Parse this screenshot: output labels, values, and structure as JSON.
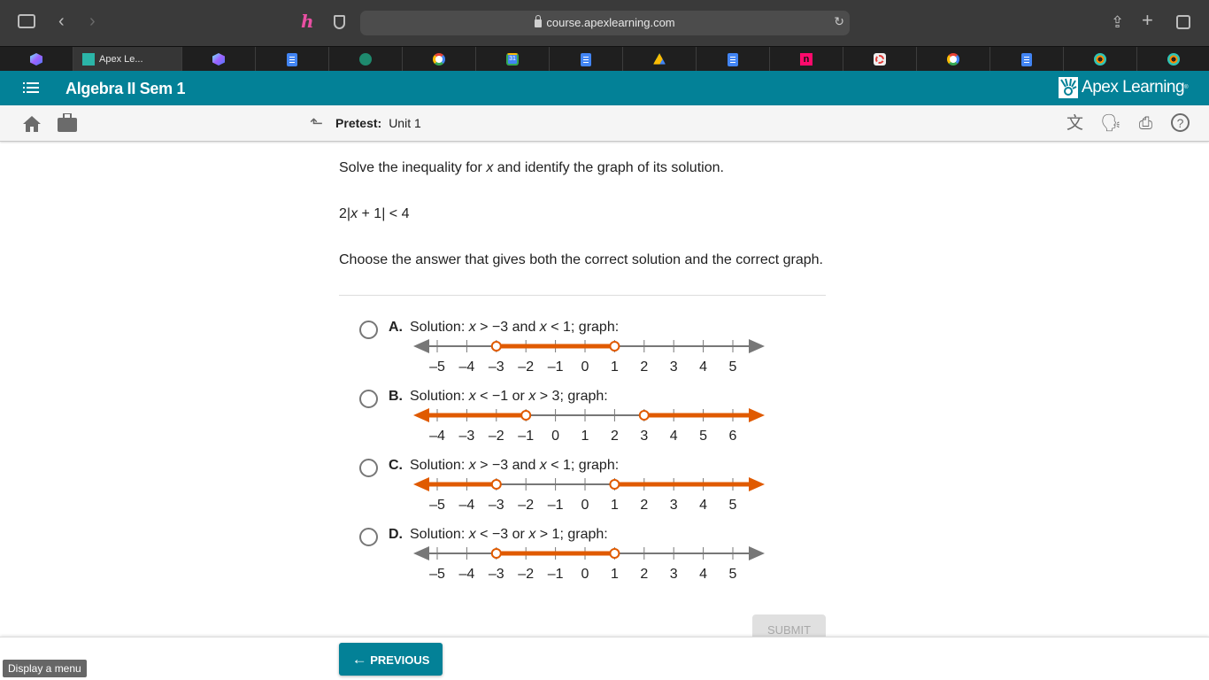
{
  "browser": {
    "url": "course.apexlearning.com",
    "tabs": [
      {
        "icon": "gem",
        "title": ""
      },
      {
        "icon": "apex",
        "title": "Apex Le...",
        "active": true
      },
      {
        "icon": "gem",
        "title": ""
      },
      {
        "icon": "doc",
        "title": ""
      },
      {
        "icon": "gpt",
        "title": ""
      },
      {
        "icon": "google",
        "title": ""
      },
      {
        "icon": "cal",
        "title": "31"
      },
      {
        "icon": "doc",
        "title": ""
      },
      {
        "icon": "drive",
        "title": ""
      },
      {
        "icon": "doc",
        "title": ""
      },
      {
        "icon": "n",
        "title": "n"
      },
      {
        "icon": "ring",
        "title": ""
      },
      {
        "icon": "google",
        "title": ""
      },
      {
        "icon": "doc",
        "title": ""
      },
      {
        "icon": "eye",
        "title": ""
      },
      {
        "icon": "eye",
        "title": ""
      }
    ]
  },
  "header": {
    "course_title": "Algebra II Sem 1",
    "brand": "Apex Learning",
    "brand_mark": "®"
  },
  "subheader": {
    "label": "Pretest:",
    "value": "Unit 1"
  },
  "question": {
    "prompt_before": "Solve the inequality for ",
    "prompt_var": "x",
    "prompt_after": " and identify the graph of its solution.",
    "equation_pre": "2|",
    "equation_var": "x",
    "equation_post": " + 1| < 4",
    "instruction": "Choose the answer that gives both the correct solution and the correct graph."
  },
  "options": [
    {
      "letter": "A.",
      "text_parts": [
        "Solution: ",
        "x",
        " > −3 and ",
        "x",
        " < 1; graph:"
      ],
      "ticks": [
        -5,
        -4,
        -3,
        -2,
        -1,
        0,
        1,
        2,
        3,
        4,
        5
      ],
      "open_points": [
        -3,
        1
      ],
      "shade": "between"
    },
    {
      "letter": "B.",
      "text_parts": [
        "Solution: ",
        "x",
        " < −1 or ",
        "x",
        " > 3; graph:"
      ],
      "ticks": [
        -4,
        -3,
        -2,
        -1,
        0,
        1,
        2,
        3,
        4,
        5,
        6
      ],
      "open_points": [
        -1,
        3
      ],
      "shade": "outside"
    },
    {
      "letter": "C.",
      "text_parts": [
        "Solution: ",
        "x",
        " > −3 and ",
        "x",
        " < 1; graph:"
      ],
      "ticks": [
        -5,
        -4,
        -3,
        -2,
        -1,
        0,
        1,
        2,
        3,
        4,
        5
      ],
      "open_points": [
        -3,
        1
      ],
      "shade": "outside"
    },
    {
      "letter": "D.",
      "text_parts": [
        "Solution: ",
        "x",
        " < −3 or ",
        "x",
        " > 1; graph:"
      ],
      "ticks": [
        -5,
        -4,
        -3,
        -2,
        -1,
        0,
        1,
        2,
        3,
        4,
        5
      ],
      "open_points": [
        -3,
        1
      ],
      "shade": "between"
    }
  ],
  "colors": {
    "accent": "#038197",
    "shade": "#e05a00",
    "axis": "#777777"
  },
  "actions": {
    "submit": "SUBMIT",
    "previous": "PREVIOUS",
    "tooltip": "Display a menu"
  }
}
